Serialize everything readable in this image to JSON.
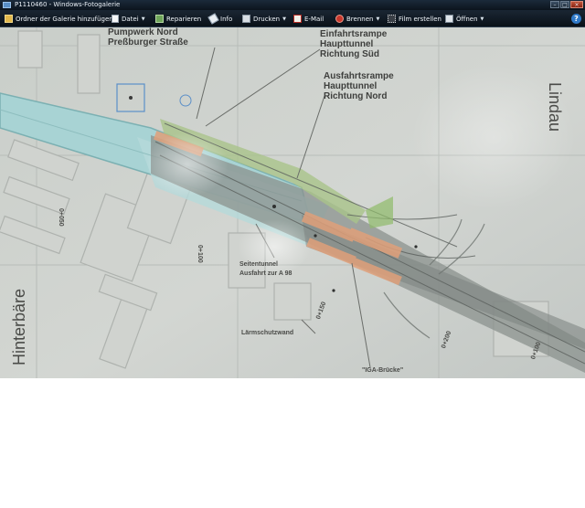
{
  "window": {
    "title": "P1110460 - Windows-Fotogalerie",
    "help": "?"
  },
  "toolbar": {
    "items": [
      {
        "label": "Ordner der Galerie hinzufügen",
        "icon": "add-folder-icon",
        "dropdown": false
      },
      {
        "label": "Datei",
        "icon": "file-icon",
        "dropdown": true
      },
      {
        "label": "Reparieren",
        "icon": "fix-icon",
        "dropdown": false
      },
      {
        "label": "Info",
        "icon": "info-tag-icon",
        "dropdown": false
      },
      {
        "label": "Drucken",
        "icon": "printer-icon",
        "dropdown": true
      },
      {
        "label": "E-Mail",
        "icon": "email-icon",
        "dropdown": false
      },
      {
        "label": "Brennen",
        "icon": "burn-disc-icon",
        "dropdown": true
      },
      {
        "label": "Film erstellen",
        "icon": "film-icon",
        "dropdown": false
      },
      {
        "label": "Öffnen",
        "icon": "open-icon",
        "dropdown": true
      }
    ]
  },
  "photo": {
    "labels": {
      "pumpwerk_1": "Pumpwerk Nord",
      "pumpwerk_2": "Preßburger Straße",
      "einfahrt_1": "Einfahrtsrampe",
      "einfahrt_2": "Haupttunnel",
      "einfahrt_3": "Richtung Süd",
      "ausfahrt_1": "Ausfahrtsrampe",
      "ausfahrt_2": "Haupttunnel",
      "ausfahrt_3": "Richtung Nord",
      "seitentunnel_1": "Seitentunnel",
      "seitentunnel_2": "Ausfahrt zur A 98",
      "laerm": "Lärmschutzwand",
      "iga": "\"IGA-Brücke\"",
      "lindau": "Lindau",
      "hinterbaere": "Hinterbäre",
      "elev_1": "0+050",
      "elev_2": "0+100",
      "elev_3": "0+150",
      "elev_4": "0+200",
      "elev_5": "0+100"
    }
  }
}
